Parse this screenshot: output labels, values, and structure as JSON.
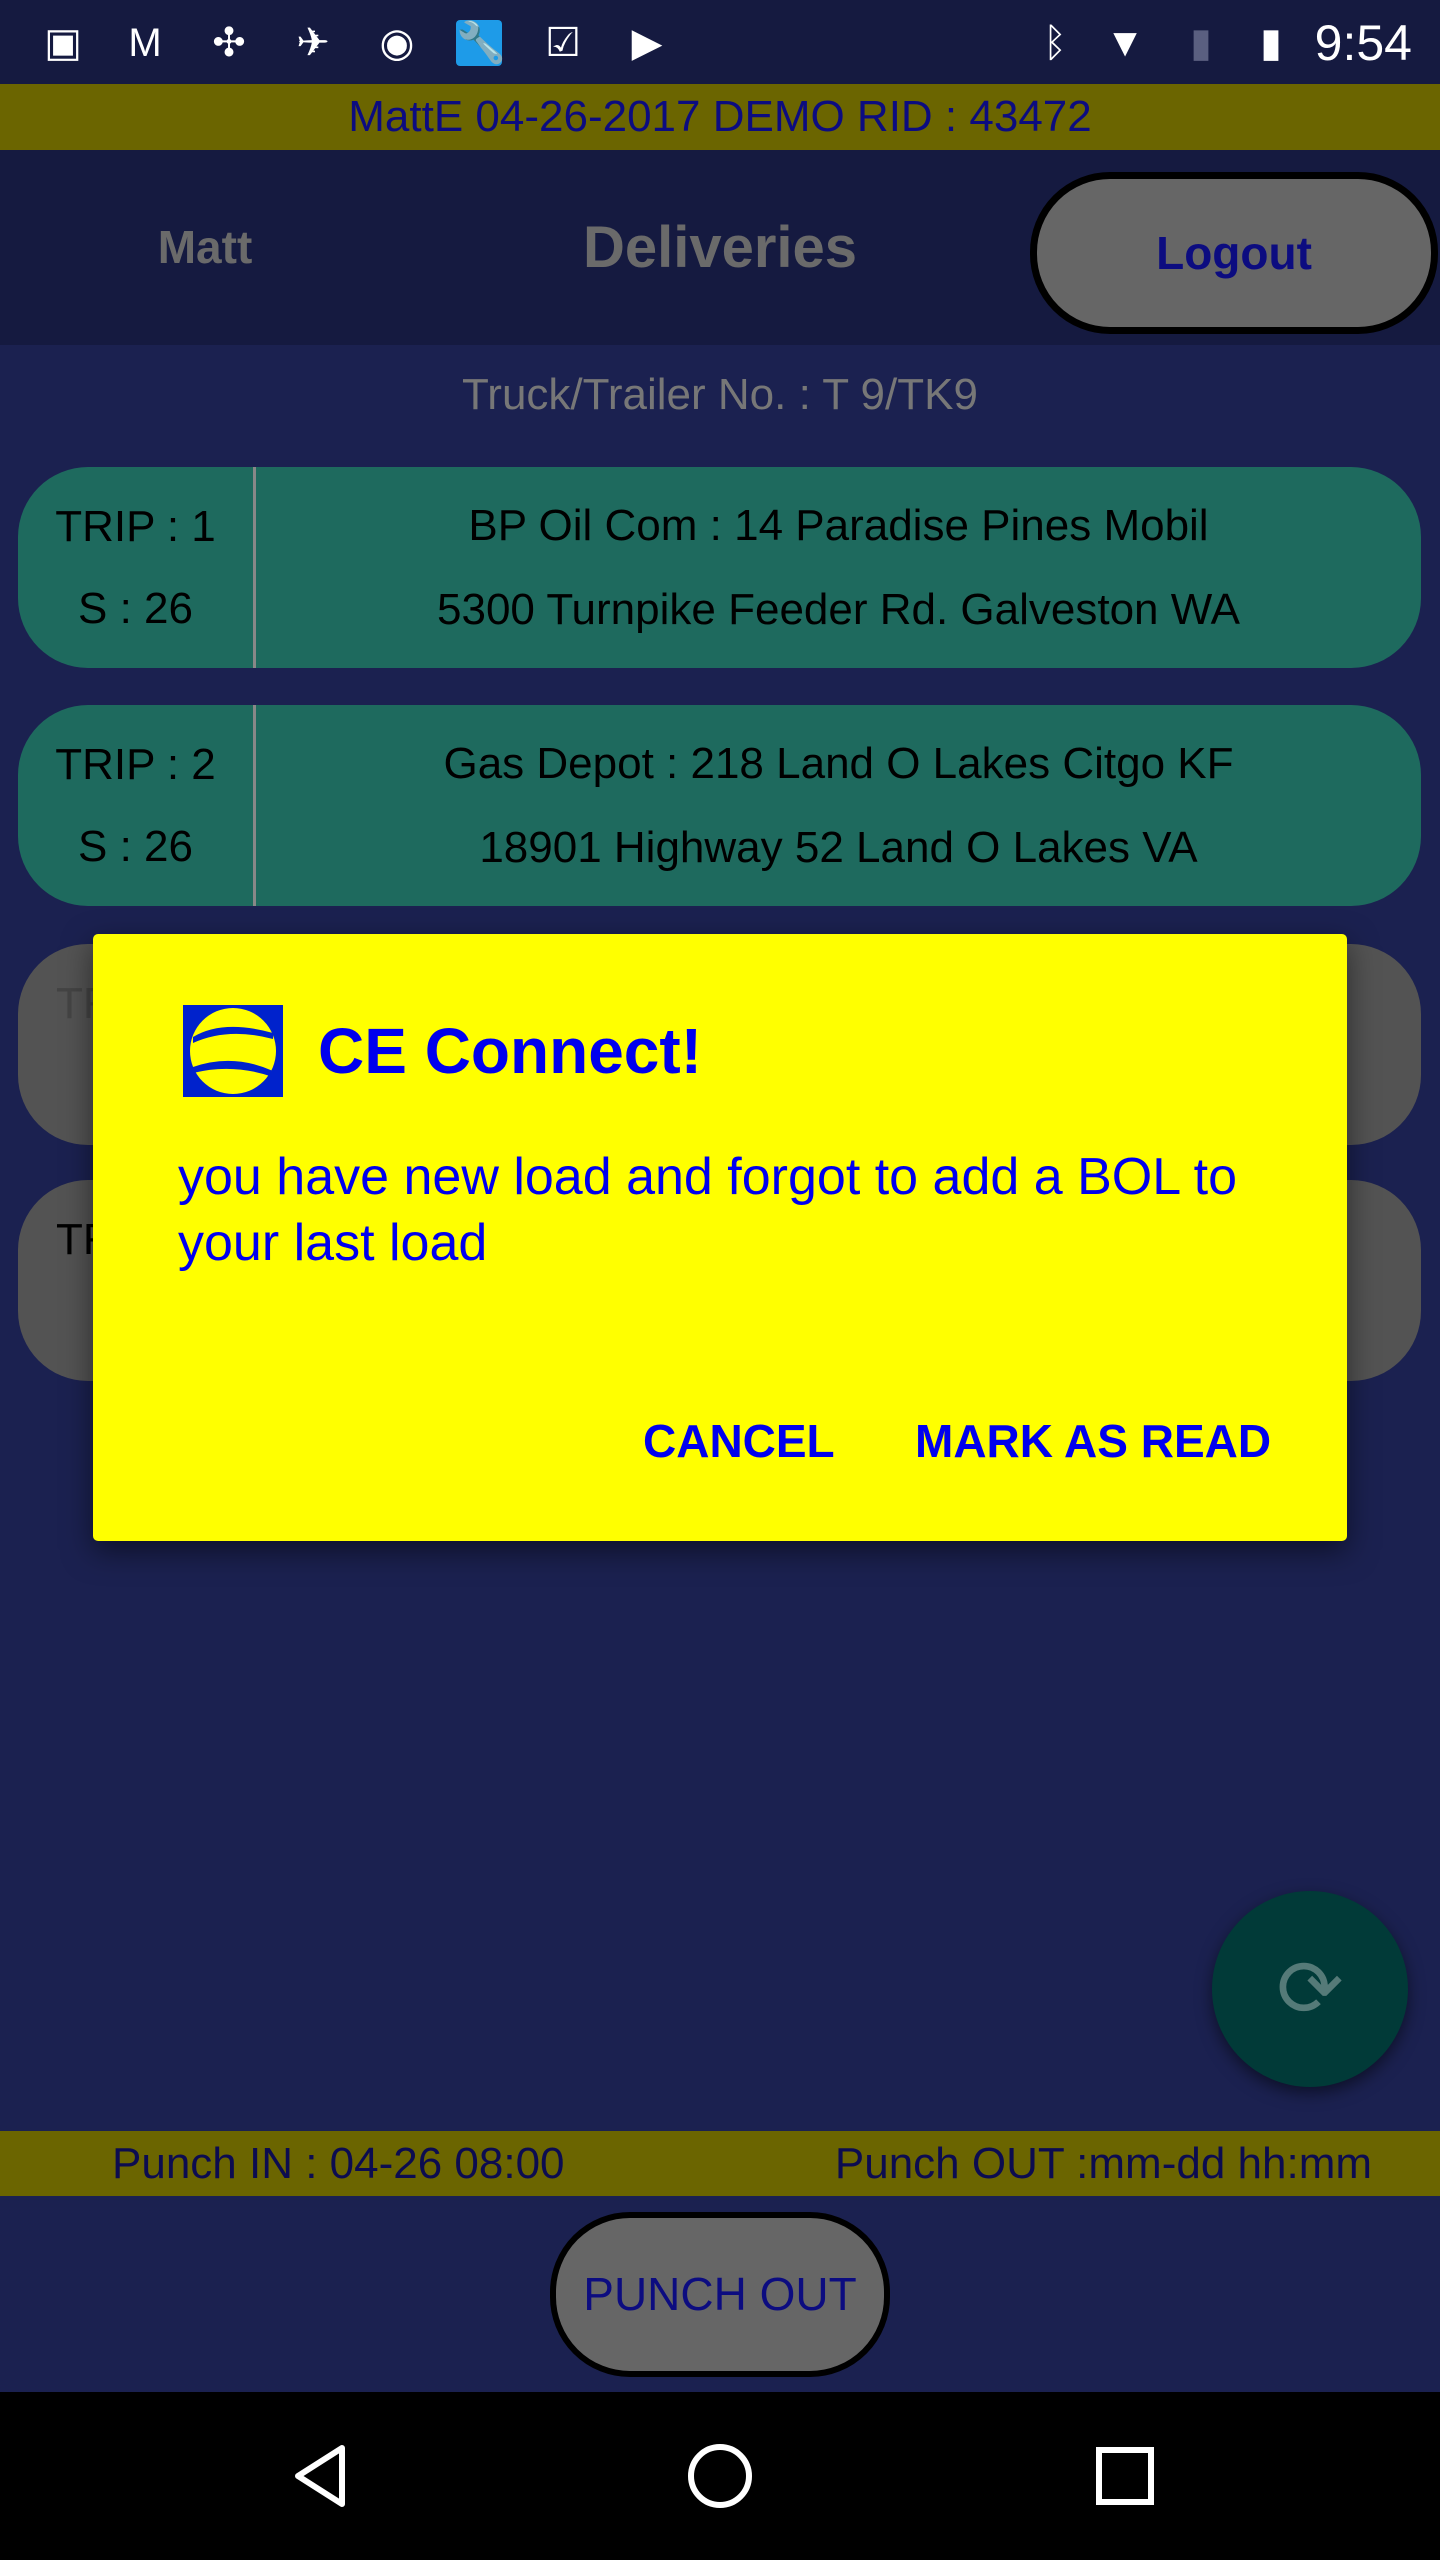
{
  "status_bar": {
    "time": "9:54",
    "icons": [
      "image-icon",
      "gmail-icon",
      "pinwheel-icon",
      "flight-icon",
      "eye-icon",
      "wrench-icon",
      "clipboard-check-icon",
      "clipboard-play-icon",
      "bluetooth-icon",
      "wifi-icon",
      "no-sim-icon",
      "battery-icon"
    ]
  },
  "info_band": "MattE 04-26-2017 DEMO RID : 43472",
  "header": {
    "user": "Matt",
    "title": "Deliveries",
    "logout": "Logout"
  },
  "truck": "Truck/Trailer No. : T 9/TK9",
  "trips": [
    {
      "trip": "TRIP : 1",
      "stop": "S : 26",
      "line1": "BP Oil Com : 14 Paradise Pines Mobil",
      "line2": "5300 Turnpike Feeder Rd. Galveston WA",
      "color": "#1e6a5e"
    },
    {
      "trip": "TRIP : 2",
      "stop": "S : 26",
      "line1": "Gas Depot : 218 Land O Lakes Citgo KF",
      "line2": "18901 Highway 52 Land O Lakes VA",
      "color": "#1e6a5e"
    },
    {
      "trip": "TR",
      "stop": "S",
      "color": "#535353"
    },
    {
      "trip": "TR",
      "stop": "S",
      "color": "#535353"
    }
  ],
  "dialog": {
    "title": "CE Connect!",
    "message": "you have new load and forgot to add a BOL to your last load",
    "cancel": "CANCEL",
    "mark_read": "MARK AS READ",
    "background": "#ffff00",
    "text_color": "#0000ee"
  },
  "fab": {
    "icon": "sync-icon"
  },
  "punch": {
    "in": "Punch IN : 04-26 08:00",
    "out": "Punch OUT :mm-dd hh:mm",
    "button": "PUNCH OUT"
  },
  "nav": {
    "icons": [
      "back-icon",
      "home-icon",
      "recents-icon"
    ]
  }
}
